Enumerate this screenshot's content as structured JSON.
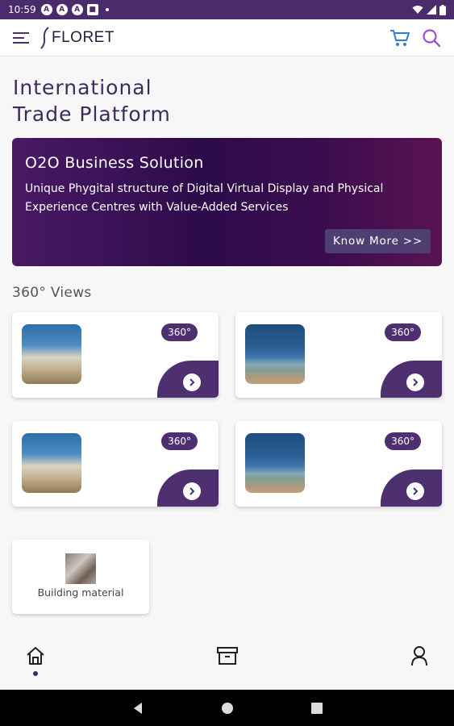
{
  "status_bar": {
    "time": "10:59",
    "notif_icons": [
      "A",
      "A",
      "A",
      "■"
    ]
  },
  "app_bar": {
    "logo_text": "FLORET",
    "menu_icon": "hamburger-icon",
    "cart_icon": "cart-icon",
    "search_icon": "search-icon"
  },
  "hero": {
    "line1": "International",
    "line2": "Trade Platform"
  },
  "banner": {
    "title": "O2O Business Solution",
    "description": "Unique Phygital structure of Digital Virtual Display and Physical Experience Centres with Value-Added Services",
    "cta": "Know More >>"
  },
  "views": {
    "title": "360° Views",
    "items": [
      {
        "badge": "360°"
      },
      {
        "badge": "360°"
      },
      {
        "badge": "360°"
      },
      {
        "badge": "360°"
      }
    ]
  },
  "categories": [
    {
      "label": "Building material"
    }
  ],
  "bottom_nav": {
    "items": [
      "home-icon",
      "archive-icon",
      "profile-icon"
    ],
    "active": 0
  },
  "colors": {
    "brand": "#4e2f70",
    "status_bar": "#4a2b6b",
    "heading": "#3e2a5e"
  }
}
